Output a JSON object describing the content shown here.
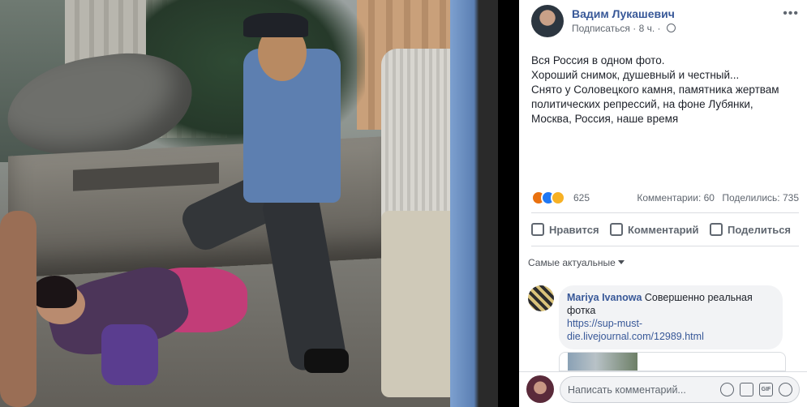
{
  "post": {
    "author_name": "Вадим Лукашевич",
    "follow_label": "Подписаться",
    "time": "· 8 ч. ·",
    "more": "•••",
    "text_lines": [
      "Вся Россия в одном фото.",
      "Хороший снимок, душевный и честный...",
      "Снято у Соловецкого камня, памятника жертвам",
      "политических репрессий, на фоне Лубянки,",
      "Москва, Россия, наше время"
    ]
  },
  "stats": {
    "reactions_count": "625",
    "comments": "Комментарии: 60",
    "shares": "Поделились: 735"
  },
  "actions": {
    "like": "Нравится",
    "comment": "Комментарий",
    "share": "Поделиться"
  },
  "comments": {
    "sort_label": "Самые актуальные",
    "items": [
      {
        "author": "Mariya Ivanowa",
        "text": "Совершенно реальная фотка",
        "link_line1": "https://sup-must-",
        "link_line2": "die.livejournal.com/12989.html"
      }
    ]
  },
  "compose": {
    "placeholder": "Написать комментарий...",
    "gif_label": "GIF"
  }
}
